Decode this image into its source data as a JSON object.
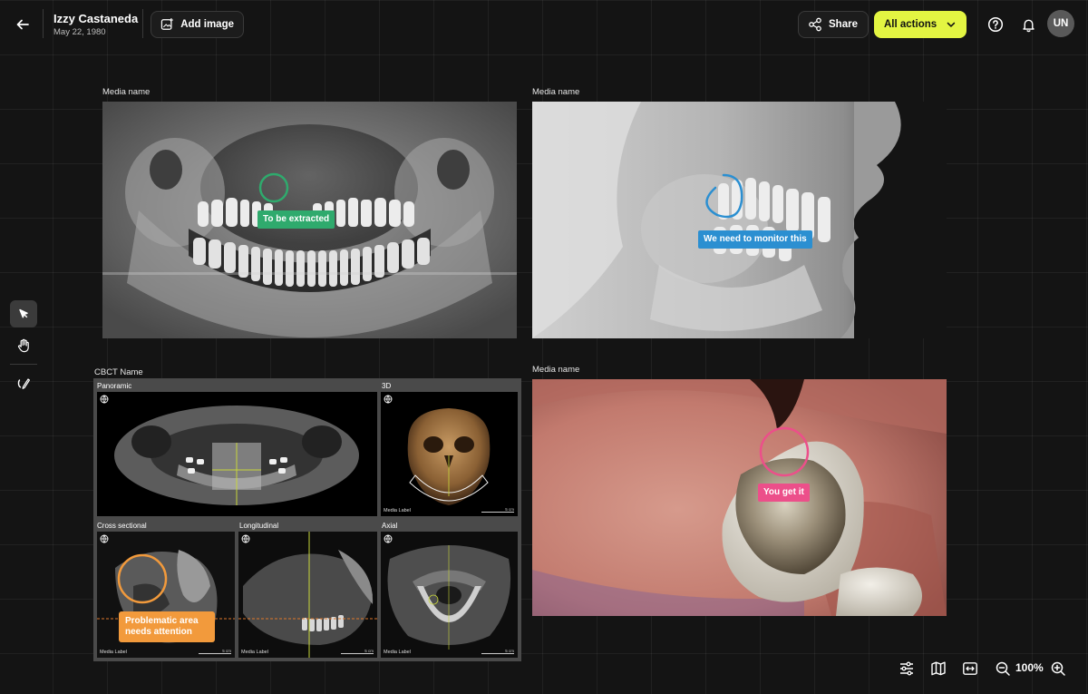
{
  "header": {
    "patient_name": "Izzy Castaneda",
    "patient_dob": "May 22, 1980",
    "add_image_label": "Add image",
    "share_label": "Share",
    "all_actions_label": "All actions",
    "avatar_initials": "UN",
    "accent_color": "#e3f542"
  },
  "toolbar": {
    "tools": [
      "cursor-icon",
      "hand-icon",
      "pen-icon"
    ],
    "active_tool": "cursor-icon"
  },
  "media": {
    "panoramic": {
      "label": "Media name",
      "annotation": "To be extracted",
      "annotation_color": "#2faa6d"
    },
    "cephalometric": {
      "label": "Media name",
      "annotation": "We need to monitor this",
      "annotation_color": "#2b8fd1"
    },
    "intraoral": {
      "label": "Media name",
      "annotation": "You get it",
      "annotation_color": "#ec4f8a"
    }
  },
  "cbct": {
    "label": "CBCT Name",
    "panels": {
      "panoramic": "Panoramic",
      "three_d": "3D",
      "cross_sectional": "Cross sectional",
      "longitudinal": "Longitudinal",
      "axial": "Axial"
    },
    "cell_label": "Media Label",
    "scale_label": "5 cm",
    "annotation": "Problematic area needs attention",
    "annotation_color": "#f29a3c"
  },
  "view_controls": {
    "zoom": "100%"
  }
}
